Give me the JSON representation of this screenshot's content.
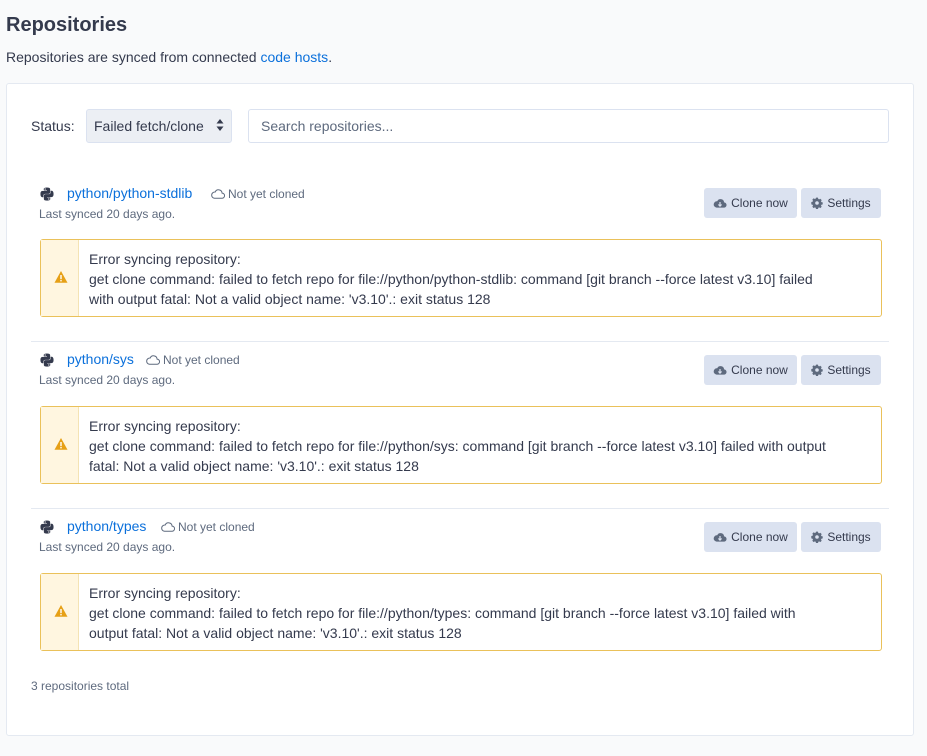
{
  "page": {
    "title": "Repositories",
    "subtitle_prefix": "Repositories are synced from connected ",
    "subtitle_link": "code hosts",
    "subtitle_suffix": "."
  },
  "filters": {
    "status_label": "Status:",
    "status_value": "Failed fetch/clone",
    "search_placeholder": "Search repositories..."
  },
  "repos": [
    {
      "name": "python/python-stdlib",
      "clone_status": "Not yet cloned",
      "last_synced": "Last synced 20 days ago.",
      "clone_button": "Clone now",
      "settings_button": "Settings",
      "error_lines": [
        "Error syncing repository:",
        "get clone command: failed to fetch repo for file://python/python-stdlib: command [git branch --force latest v3.10] failed",
        "with output fatal: Not a valid object name: 'v3.10'.: exit status 128"
      ]
    },
    {
      "name": "python/sys",
      "clone_status": "Not yet cloned",
      "last_synced": "Last synced 20 days ago.",
      "clone_button": "Clone now",
      "settings_button": "Settings",
      "error_lines": [
        "Error syncing repository:",
        "get clone command: failed to fetch repo for file://python/sys: command [git branch --force latest v3.10] failed with output",
        "fatal: Not a valid object name: 'v3.10'.: exit status 128"
      ]
    },
    {
      "name": "python/types",
      "clone_status": "Not yet cloned",
      "last_synced": "Last synced 20 days ago.",
      "clone_button": "Clone now",
      "settings_button": "Settings",
      "error_lines": [
        "Error syncing repository:",
        "get clone command: failed to fetch repo for file://python/types: command [git branch --force latest v3.10] failed with",
        "output fatal: Not a valid object name: 'v3.10'.: exit status 128"
      ]
    }
  ],
  "footer": {
    "total": "3 repositories total"
  },
  "colors": {
    "link": "#0b70db",
    "warning_border": "#eac15a",
    "warning_icon": "#e6a016",
    "button_bg": "#dbe2f0"
  },
  "icons": {
    "repo": "python-logo-icon",
    "clone_status": "cloud-icon",
    "clone_button": "cloud-download-icon",
    "settings_button": "gear-icon",
    "alert": "warning-triangle-icon"
  }
}
